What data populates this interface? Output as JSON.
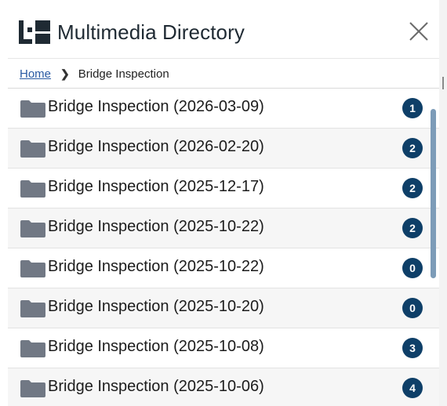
{
  "header": {
    "title": "Multimedia Directory",
    "logo_icon": "brand-logo",
    "close_icon": "close-icon"
  },
  "breadcrumb": {
    "home_label": "Home",
    "separator": "❯",
    "current_label": "Bridge Inspection"
  },
  "colors": {
    "badge": "#0e3f68",
    "folder": "#717884",
    "link": "#2a5aa3",
    "scroll_thumb": "#7d9cb8"
  },
  "folders": [
    {
      "label": "Bridge Inspection (2026-03-09)",
      "count": "1"
    },
    {
      "label": "Bridge Inspection (2026-02-20)",
      "count": "2"
    },
    {
      "label": "Bridge Inspection (2025-12-17)",
      "count": "2"
    },
    {
      "label": "Bridge Inspection (2025-10-22)",
      "count": "2"
    },
    {
      "label": "Bridge Inspection (2025-10-22)",
      "count": "0"
    },
    {
      "label": "Bridge Inspection (2025-10-20)",
      "count": "0"
    },
    {
      "label": "Bridge Inspection (2025-10-08)",
      "count": "3"
    },
    {
      "label": "Bridge Inspection (2025-10-06)",
      "count": "4"
    }
  ]
}
